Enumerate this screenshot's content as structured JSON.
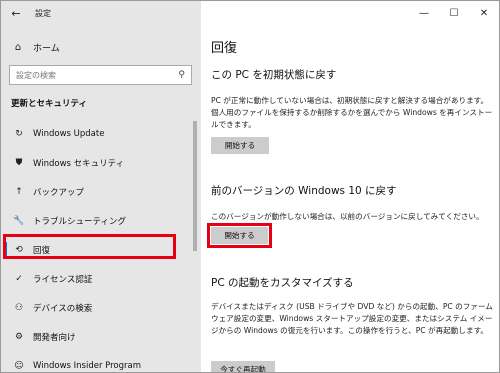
{
  "titlebar": {
    "title": "設定",
    "back_icon": "←",
    "minimize": "—",
    "maximize": "☐",
    "close": "✕"
  },
  "sidebar": {
    "home_label": "ホーム",
    "search_placeholder": "設定の検索",
    "section_label": "更新とセキュリティ",
    "items": [
      {
        "label": "Windows Update",
        "icon": "sync-icon",
        "glyph": "↻"
      },
      {
        "label": "Windows セキュリティ",
        "icon": "shield-icon",
        "glyph": "⛊"
      },
      {
        "label": "バックアップ",
        "icon": "upload-arrow-icon",
        "glyph": "↑"
      },
      {
        "label": "トラブルシューティング",
        "icon": "wrench-icon",
        "glyph": "🔧"
      },
      {
        "label": "回復",
        "icon": "history-icon",
        "glyph": "⟲"
      },
      {
        "label": "ライセンス認証",
        "icon": "check-circle-icon",
        "glyph": "✓"
      },
      {
        "label": "デバイスの検索",
        "icon": "person-location-icon",
        "glyph": "⚇"
      },
      {
        "label": "開発者向け",
        "icon": "developer-icon",
        "glyph": "⚙"
      },
      {
        "label": "Windows Insider Program",
        "icon": "insider-icon",
        "glyph": "☺"
      }
    ],
    "selected_index": 4
  },
  "main": {
    "title": "回復",
    "reset": {
      "heading": "この PC を初期状態に戻す",
      "description": "PC が正常に動作していない場合は、初期状態に戻すと解決する場合があります。個人用のファイルを保持するか削除するかを選んでから Windows を再インストールできます。",
      "button": "開始する"
    },
    "previous": {
      "heading": "前のバージョンの Windows 10 に戻す",
      "description": "このバージョンが動作しない場合は、以前のバージョンに戻してみてください。",
      "button": "開始する"
    },
    "advanced": {
      "heading": "PC の起動をカスタマイズする",
      "description": "デバイスまたはディスク (USB ドライブや DVD など) からの起動、PC のファームウェア設定の変更、Windows スタートアップ設定の変更、またはシステム イメージからの Windows の復元を行います。この操作を行うと、PC が再起動します。",
      "button": "今すぐ再起動"
    }
  },
  "colors": {
    "accent": "#0078d7",
    "highlight": "#e60012",
    "sidebar_bg": "#e6e6e6",
    "button_bg": "#cccccc"
  }
}
